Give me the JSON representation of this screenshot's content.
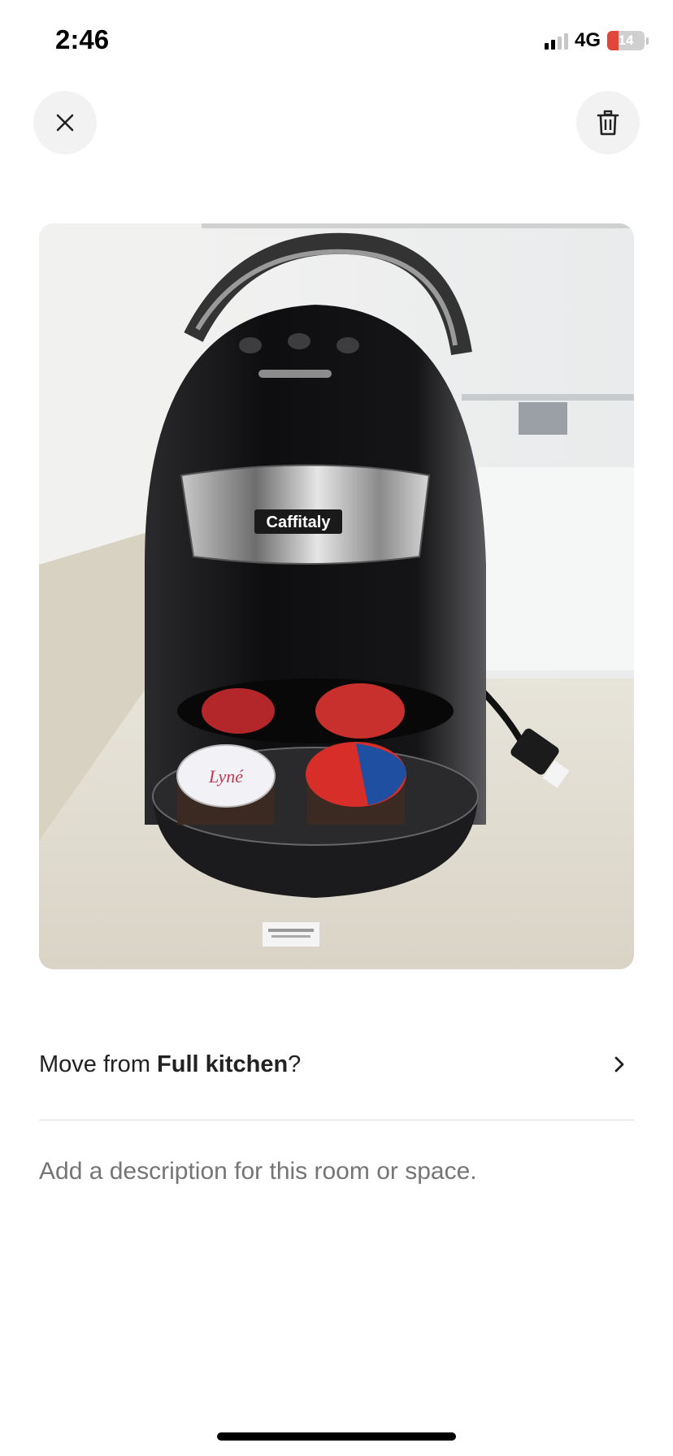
{
  "status_bar": {
    "time": "2:46",
    "network": "4G",
    "battery_level": "14",
    "signal_bars_active": 2,
    "signal_bars_total": 4
  },
  "header": {
    "close_icon": "close-icon",
    "delete_icon": "trash-icon"
  },
  "photo": {
    "brand_label": "Caffitaly"
  },
  "move_row": {
    "prefix": "Move from ",
    "room": "Full kitchen",
    "suffix": "?",
    "icon": "chevron-right-icon"
  },
  "description": {
    "placeholder": "Add a description for this room or space."
  },
  "colors": {
    "text_primary": "#222222",
    "text_secondary": "#717171",
    "button_bg": "#f2f2f2",
    "battery_low": "#e0463a"
  }
}
